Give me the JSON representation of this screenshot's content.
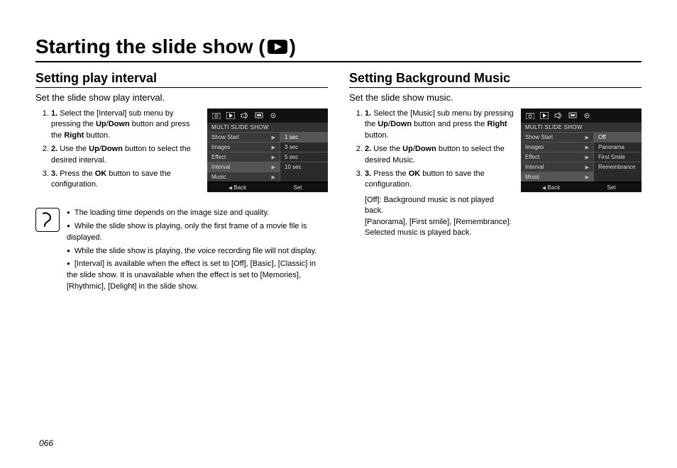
{
  "title_prefix": "Starting the slide show (",
  "title_suffix": " )",
  "page_number": "066",
  "left": {
    "heading": "Setting play interval",
    "intro": "Set the slide show play interval.",
    "steps": [
      {
        "n": "1.",
        "pre": "Select the [Interval] sub menu by pressing the ",
        "b1": "Up",
        "mid1": "/",
        "b2": "Down",
        "mid2": " button and press the ",
        "b3": "Right",
        "post": " button."
      },
      {
        "n": "2.",
        "pre": "Use the ",
        "b1": "Up",
        "mid1": "/",
        "b2": "Down",
        "mid2": " button to select the desired interval.",
        "b3": "",
        "post": ""
      },
      {
        "n": "3.",
        "pre": "Press the ",
        "b1": "OK",
        "mid1": " button to save the configuration.",
        "b2": "",
        "mid2": "",
        "b3": "",
        "post": ""
      }
    ],
    "menu": {
      "header": "MULTI SLIDE SHOW",
      "items": [
        "Show Start",
        "Images",
        "Effect",
        "Interval",
        "Music"
      ],
      "options": [
        "1 sec",
        "3 sec",
        "5 sec",
        "10 sec"
      ],
      "footer_left": "Back",
      "footer_right": "Set"
    },
    "notes": [
      "The loading time depends on the image size and quality.",
      "While the slide show is playing, only the first frame of a movie file is displayed.",
      "While the slide show is playing, the voice recording file will not display.",
      "[Interval] is available when the effect is set to [Off], [Basic], [Classic] in the slide show. It is unavailable when the effect is set to [Memories], [Rhythmic], [Delight] in the slide show."
    ]
  },
  "right": {
    "heading": "Setting Background Music",
    "intro": "Set the slide show music.",
    "steps": [
      {
        "n": "1.",
        "pre": "Select the [Music] sub menu by pressing the ",
        "b1": "Up",
        "mid1": "/",
        "b2": "Down",
        "mid2": " button and press the ",
        "b3": "Right",
        "post": " button."
      },
      {
        "n": "2.",
        "pre": "Use the ",
        "b1": "Up",
        "mid1": "/",
        "b2": "Down",
        "mid2": " button to select the desired Music.",
        "b3": "",
        "post": ""
      },
      {
        "n": "3.",
        "pre": "Press the ",
        "b1": "OK",
        "mid1": " button to save the configuration.",
        "b2": "",
        "mid2": "",
        "b3": "",
        "post": ""
      }
    ],
    "extra": [
      "[Off]: Background music is not played back.",
      "[Panorama], [First smile], [Remembrance]: Selected music is played back."
    ],
    "menu": {
      "header": "MULTI SLIDE SHOW",
      "items": [
        "Show Start",
        "Images",
        "Effect",
        "Interval",
        "Music"
      ],
      "options": [
        "Off",
        "Panorama",
        "First Smile",
        "Remembrance"
      ],
      "footer_left": "Back",
      "footer_right": "Set"
    }
  }
}
